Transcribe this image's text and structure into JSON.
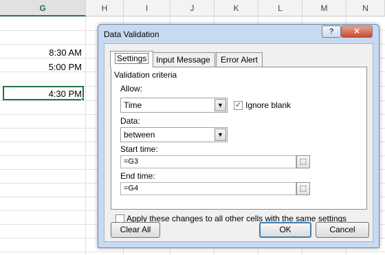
{
  "sheet": {
    "columns": [
      "G",
      "H",
      "I",
      "J",
      "K",
      "L",
      "M",
      "N"
    ],
    "cells": [
      "8:30 AM",
      "5:00 PM",
      "4:30 PM"
    ]
  },
  "dialog": {
    "title": "Data Validation",
    "help_label": "?",
    "close_label": "✕",
    "tabs": [
      "Settings",
      "Input Message",
      "Error Alert"
    ],
    "section": "Validation criteria",
    "allow_label": "Allow:",
    "allow_value": "Time",
    "ignore_blank_label": "Ignore blank",
    "ignore_blank_checked": "✓",
    "data_label": "Data:",
    "data_value": "between",
    "start_label": "Start time:",
    "start_value": "=G3",
    "end_label": "End time:",
    "end_value": "=G4",
    "apply_label": "Apply these changes to all other cells with the same settings",
    "clear_all_label": "Clear All",
    "ok_label": "OK",
    "cancel_label": "Cancel",
    "ref_icon": "⬚"
  }
}
